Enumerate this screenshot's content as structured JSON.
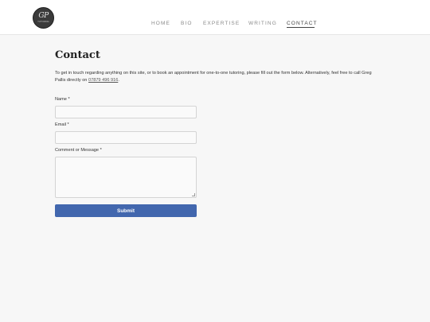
{
  "header": {
    "logo": {
      "mark": "GP",
      "sub": "TUTORING"
    },
    "nav": [
      {
        "label": "HOME"
      },
      {
        "label": "BIO"
      },
      {
        "label": "EXPERTISE"
      },
      {
        "label": "WRITING"
      },
      {
        "label": "CONTACT",
        "active": true
      }
    ]
  },
  "main": {
    "title": "Contact",
    "intro_text": "To get in touch regarding anything on this site, or to book an appointment for one-to-one tutoring, please fill out the form below. Alternatively, feel free to call Greg Pallis directly on ",
    "phone": "07879 496 916",
    "intro_end": ".",
    "form": {
      "name_label": "Name *",
      "email_label": "Email *",
      "message_label": "Comment or Message *",
      "submit_label": "Submit"
    }
  },
  "colors": {
    "page_bg": "#f7f7f7",
    "header_bg": "#ffffff",
    "submit_bg": "#4267ae"
  }
}
